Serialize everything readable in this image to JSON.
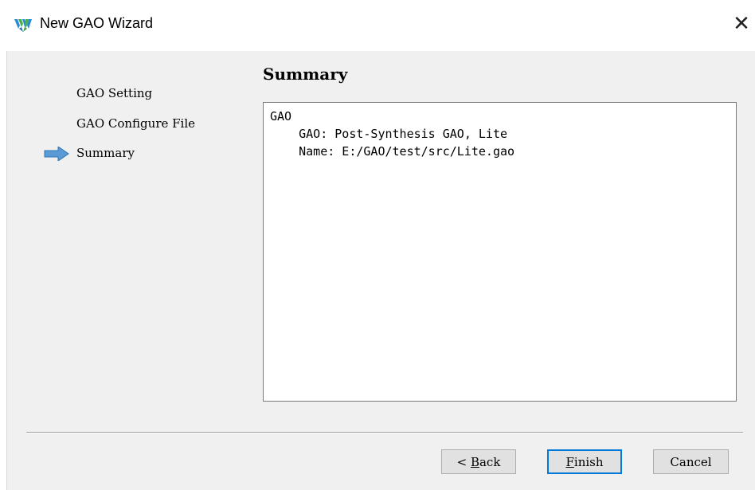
{
  "window": {
    "title": "New GAO Wizard",
    "close_glyph": "✕",
    "app_icon": "gowin-logo-icon"
  },
  "colors": {
    "accent": "#0078d7",
    "panel_bg": "#f0f0f0",
    "arrow_fill": "#5b9bd5"
  },
  "steps": [
    {
      "label": "GAO Setting",
      "current": false
    },
    {
      "label": "GAO Configure File",
      "current": false
    },
    {
      "label": "Summary",
      "current": true
    }
  ],
  "page": {
    "heading": "Summary"
  },
  "summary": {
    "lines": [
      "GAO",
      "    GAO: Post-Synthesis GAO, Lite",
      "    Name: E:/GAO/test/src/Lite.gao"
    ]
  },
  "buttons": {
    "back": {
      "prefix": "< ",
      "mnemonic": "B",
      "rest": "ack"
    },
    "finish": {
      "prefix": "",
      "mnemonic": "F",
      "rest": "inish"
    },
    "cancel": {
      "prefix": "",
      "mnemonic": "",
      "rest": "Cancel"
    }
  }
}
